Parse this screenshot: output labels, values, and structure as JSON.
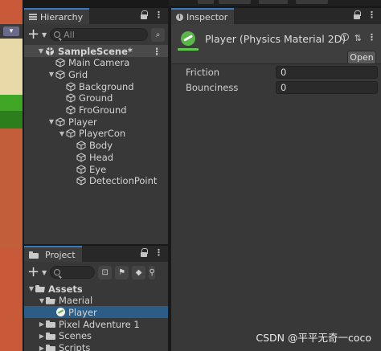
{
  "scene": {
    "mode_label": ""
  },
  "hierarchy": {
    "tab": "Hierarchy",
    "search_placeholder": "All",
    "items": [
      {
        "label": "SampleScene*",
        "depth": 0,
        "kind": "scene",
        "expanded": true
      },
      {
        "label": "Main Camera",
        "depth": 1,
        "kind": "object"
      },
      {
        "label": "Grid",
        "depth": 1,
        "kind": "object",
        "expanded": true
      },
      {
        "label": "Background",
        "depth": 2,
        "kind": "object"
      },
      {
        "label": "Ground",
        "depth": 2,
        "kind": "object"
      },
      {
        "label": "FroGround",
        "depth": 2,
        "kind": "object"
      },
      {
        "label": "Player",
        "depth": 1,
        "kind": "object",
        "expanded": true
      },
      {
        "label": "PlayerCon",
        "depth": 2,
        "kind": "object",
        "expanded": true
      },
      {
        "label": "Body",
        "depth": 3,
        "kind": "object"
      },
      {
        "label": "Head",
        "depth": 3,
        "kind": "object"
      },
      {
        "label": "Eye",
        "depth": 3,
        "kind": "object"
      },
      {
        "label": "DetectionPoint",
        "depth": 3,
        "kind": "object"
      }
    ]
  },
  "inspector": {
    "tab": "Inspector",
    "title": "Player (Physics Material 2D)",
    "open_button": "Open",
    "fields": [
      {
        "label": "Friction",
        "value": "0"
      },
      {
        "label": "Bounciness",
        "value": "0"
      }
    ]
  },
  "project": {
    "tab": "Project",
    "items": [
      {
        "label": "Assets",
        "depth": 0,
        "kind": "folder-open",
        "bold": true
      },
      {
        "label": "Maerial",
        "depth": 1,
        "kind": "folder-open"
      },
      {
        "label": "Player",
        "depth": 2,
        "kind": "material",
        "selected": true
      },
      {
        "label": "Pixel Adventure 1",
        "depth": 1,
        "kind": "folder"
      },
      {
        "label": "Scenes",
        "depth": 1,
        "kind": "folder"
      },
      {
        "label": "Scripts",
        "depth": 1,
        "kind": "folder"
      }
    ]
  },
  "watermark": "CSDN @平平无奇一coco",
  "colors": {
    "accent": "#3a79bb",
    "selection": "#2c5d87",
    "material_green": "#5ab54a"
  }
}
